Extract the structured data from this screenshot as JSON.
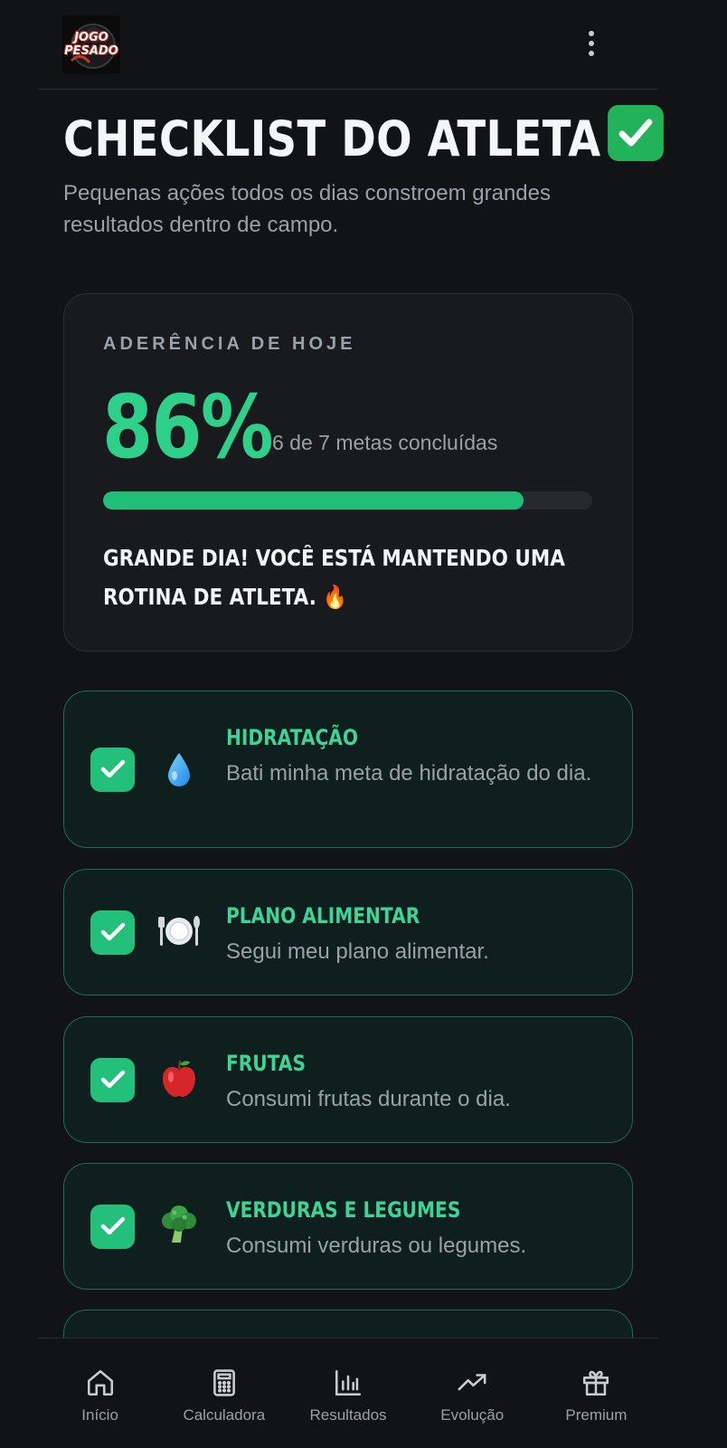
{
  "header": {
    "logo_line1": "JOGO",
    "logo_line2": "PESADO",
    "menu_icon": "more-vertical-icon"
  },
  "page": {
    "title": "CHECKLIST DO ATLETA",
    "title_icon": "check-mark-button-icon",
    "subtitle": "Pequenas ações todos os dias constroem grandes resultados dentro de campo."
  },
  "summary": {
    "label": "ADERÊNCIA DE HOJE",
    "percent": "86%",
    "count": "6 de 7 metas concluídas",
    "progress": 0.86,
    "message": "GRANDE DIA! VOCÊ ESTÁ MANTENDO UMA ROTINA DE ATLETA. 🔥"
  },
  "items": [
    {
      "title": "HIDRATAÇÃO",
      "description": "Bati minha meta de hidratação do dia.",
      "icon": "water-drop-icon",
      "checked": true
    },
    {
      "title": "PLANO ALIMENTAR",
      "description": "Segui meu plano alimentar.",
      "icon": "plate-cutlery-icon",
      "checked": true
    },
    {
      "title": "FRUTAS",
      "description": "Consumi frutas durante o dia.",
      "icon": "apple-icon",
      "checked": true
    },
    {
      "title": "VERDURAS E LEGUMES",
      "description": "Consumi verduras ou legumes.",
      "icon": "broccoli-icon",
      "checked": true
    }
  ],
  "nav": [
    {
      "label": "Início",
      "icon": "home-icon"
    },
    {
      "label": "Calculadora",
      "icon": "calculator-icon"
    },
    {
      "label": "Resultados",
      "icon": "bar-chart-icon"
    },
    {
      "label": "Evolução",
      "icon": "trending-up-icon"
    },
    {
      "label": "Premium",
      "icon": "gift-icon"
    }
  ],
  "colors": {
    "background": "#111316",
    "accent": "#2ed08a",
    "card_border": "#1f6b4d",
    "checkbox": "#22c07a"
  }
}
